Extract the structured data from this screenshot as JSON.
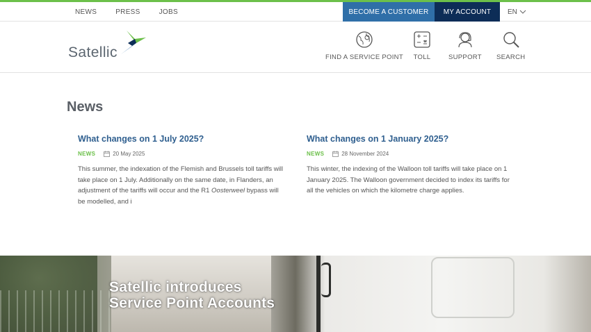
{
  "utility": {
    "links": [
      "NEWS",
      "PRESS",
      "JOBS"
    ],
    "become_customer": "BECOME A CUSTOMER",
    "my_account": "MY ACCOUNT",
    "language": "EN"
  },
  "brand": {
    "name": "Satellic"
  },
  "nav": [
    {
      "label": "FIND A SERVICE POINT",
      "icon": "service-point-globe-icon"
    },
    {
      "label": "TOLL",
      "icon": "calculator-icon"
    },
    {
      "label": "SUPPORT",
      "icon": "headset-icon"
    },
    {
      "label": "SEARCH",
      "icon": "search-icon"
    }
  ],
  "page": {
    "title": "News"
  },
  "articles": [
    {
      "title": "What changes on 1 July 2025?",
      "tag": "NEWS",
      "date": "20 May 2025",
      "excerpt_before": "This summer, the indexation of the Flemish and Brussels toll tariffs will take place on 1 July.  Additionally on the same date, in Flanders, an adjustment of the tariffs will occur and the R1 ",
      "excerpt_em": "Oosterweel",
      "excerpt_after": " bypass will be modelled, and i"
    },
    {
      "title": "What changes on 1 January 2025?",
      "tag": "NEWS",
      "date": "28 November 2024",
      "excerpt": "This winter, the indexing of the Walloon toll tariffs will take place on 1 January 2025. The Walloon government decided to index its tariffs for all the vehicles on which the kilometre charge applies."
    }
  ],
  "hero": {
    "line1": "Satellic introduces",
    "line2": "Service Point Accounts"
  },
  "colors": {
    "accent_green": "#6cc04a",
    "become_customer_bg": "#2f6fa8",
    "my_account_bg": "#0d2d57",
    "article_title": "#2f5f8f"
  }
}
